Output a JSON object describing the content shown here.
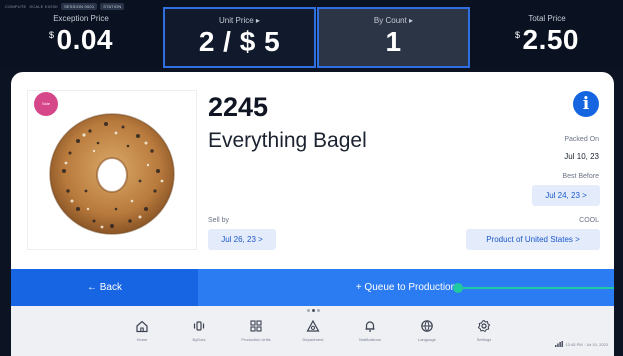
{
  "topbar": {
    "meta": [
      "COMPUTE",
      "SCALE KIOSK",
      "SESSION 0001",
      "STATION"
    ],
    "exception": {
      "label": "Exception Price",
      "currency": "$",
      "value": "0.04"
    },
    "unit": {
      "label": "Unit Price ▸",
      "value": "2 / $ 5"
    },
    "count": {
      "label": "By Count ▸",
      "value": "1"
    },
    "total": {
      "label": "Total Price",
      "currency": "$",
      "value": "2.50"
    }
  },
  "product": {
    "badge": "Sale",
    "plu": "2245",
    "name": "Everything Bagel",
    "packed_on_label": "Packed On",
    "packed_on": "Jul 10, 23",
    "best_before_label": "Best Before",
    "best_before": "Jul 24, 23 >",
    "sell_by_label": "Sell by",
    "sell_by": "Jul 26, 23 >",
    "coo_label": "COOL",
    "coo": "Product of United States >"
  },
  "actions": {
    "back": "← Back",
    "queue": "+ Queue to Production"
  },
  "nav": [
    {
      "label": "Home",
      "icon": "home-icon"
    },
    {
      "label": "ByDots",
      "icon": "scale-icon"
    },
    {
      "label": "Production Units",
      "icon": "grid-icon"
    },
    {
      "label": "Department",
      "icon": "department-icon"
    },
    {
      "label": "Notifications",
      "icon": "bell-icon"
    },
    {
      "label": "Language",
      "icon": "globe-icon"
    },
    {
      "label": "Settings",
      "icon": "settings-icon"
    }
  ],
  "status": {
    "time": "12:45 PM · Jul 10, 2023"
  },
  "colors": {
    "accent": "#1765e3",
    "queue": "#2b7bf2",
    "badge": "#d6478a",
    "pointer": "#20c9a0"
  }
}
